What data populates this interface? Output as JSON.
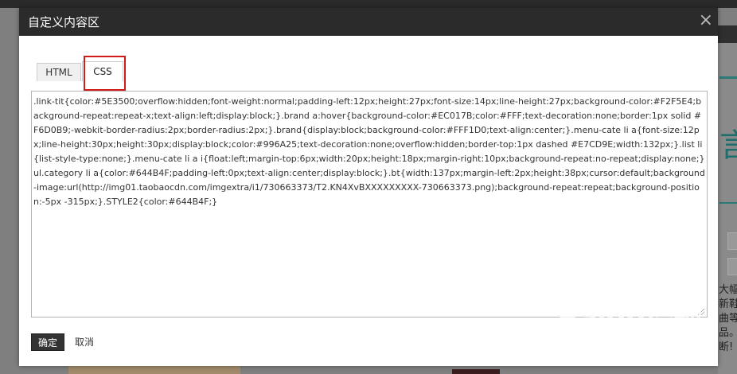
{
  "dialog": {
    "title": "自定义内容区",
    "close_glyph": "×"
  },
  "tabs": [
    {
      "label": "HTML",
      "active": false
    },
    {
      "label": "CSS",
      "active": true
    }
  ],
  "editor": {
    "content": ".link-tit{color:#5E3500;overflow:hidden;font-weight:normal;padding-left:12px;height:27px;font-size:14px;line-height:27px;background-color:#F2F5E4;background-repeat:repeat-x;text-align:left;display:block;}.brand a:hover{background-color:#EC017B;color:#FFF;text-decoration:none;border:1px solid #F6D0B9;-webkit-border-radius:2px;border-radius:2px;}.brand{display:block;background-color:#FFF1D0;text-align:center;}.menu-cate li a{font-size:12px;line-height:30px;height:30px;display:block;color:#996A25;text-decoration:none;overflow:hidden;border-top:1px dashed #E7CD9E;width:132px;}.list li{list-style-type:none;}.menu-cate li a i{float:left;margin-top:6px;width:20px;height:18px;margin-right:10px;background-repeat:no-repeat;display:none;}ul.category li a{color:#644B4F;padding-left:0px;text-align:center;display:block;}.bt{width:137px;margin-left:2px;height:38px;cursor:default;background-image:url(http://img01.taobaocdn.com/imgextra/i1/730663373/T2.KN4XvBXXXXXXXXX-730663373.png);background-repeat:repeat;background-position:-5px -315px;}.STYLE2{color:#644B4F;}"
  },
  "buttons": {
    "ok_label": "确定",
    "cancel_label": "取消"
  },
  "background": {
    "right_text": "大幅\n新鞋\n曲等\n品。\n断!"
  },
  "watermark": {
    "main": "Baidu经验",
    "sub": "jingyan.baidu.com"
  }
}
